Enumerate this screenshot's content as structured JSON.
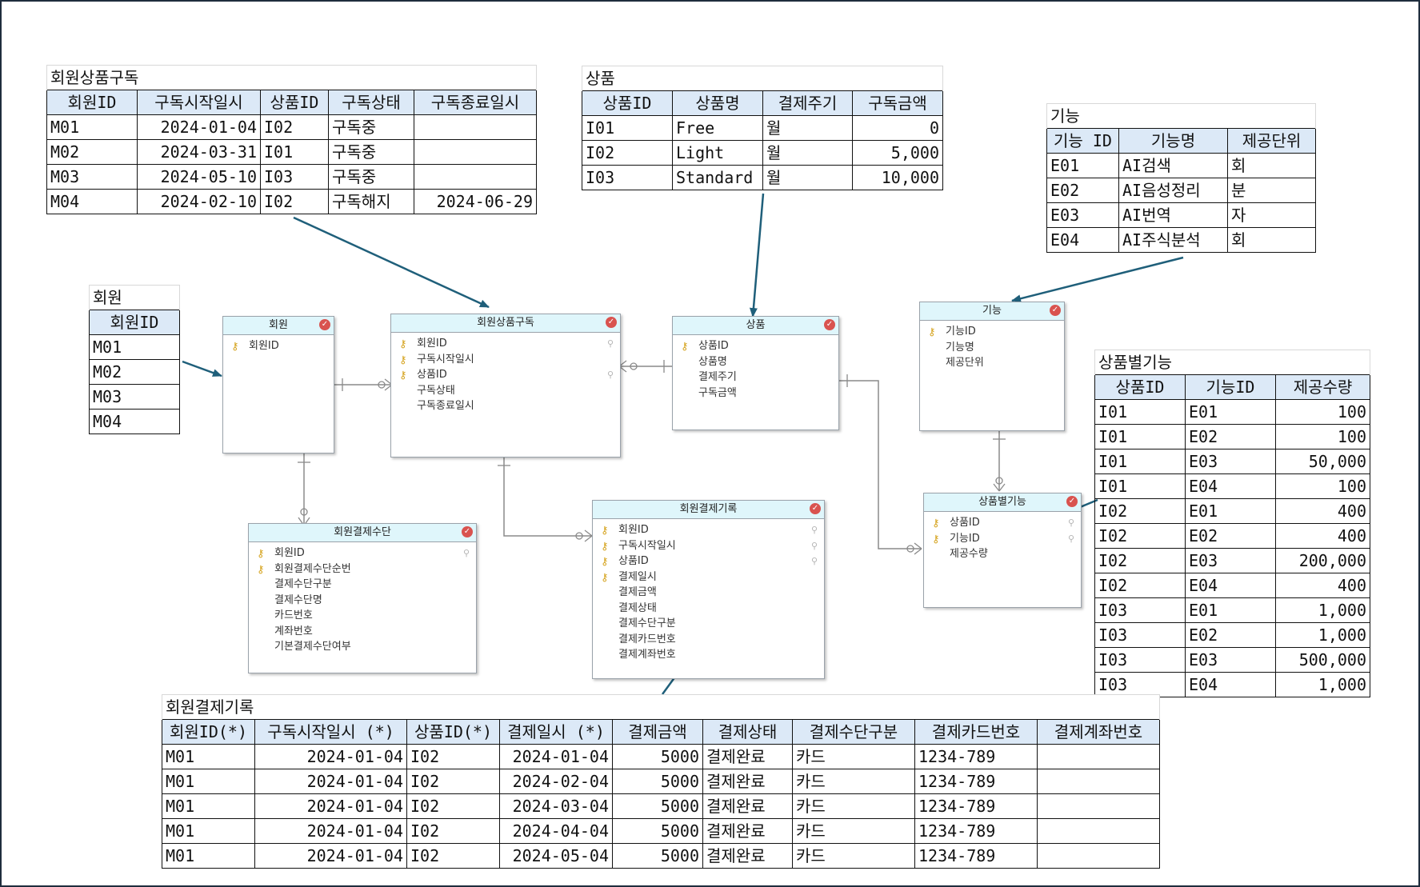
{
  "sample_tables": {
    "subscription": {
      "caption": "회원상품구독",
      "headers": [
        "회원ID",
        "구독시작일시",
        "상품ID",
        "구독상태",
        "구독종료일시"
      ],
      "rows": [
        [
          "M01",
          "2024-01-04",
          "I02",
          "구독중",
          ""
        ],
        [
          "M02",
          "2024-03-31",
          "I01",
          "구독중",
          ""
        ],
        [
          "M03",
          "2024-05-10",
          "I03",
          "구독중",
          ""
        ],
        [
          "M04",
          "2024-02-10",
          "I02",
          "구독해지",
          "2024-06-29"
        ]
      ]
    },
    "product": {
      "caption": "상품",
      "headers": [
        "상품ID",
        "상품명",
        "결제주기",
        "구독금액"
      ],
      "rows": [
        [
          "I01",
          "Free",
          "월",
          "0"
        ],
        [
          "I02",
          "Light",
          "월",
          "5,000"
        ],
        [
          "I03",
          "Standard",
          "월",
          "10,000"
        ]
      ]
    },
    "feature": {
      "caption": "기능",
      "headers": [
        "기능 ID",
        "기능명",
        "제공단위"
      ],
      "rows": [
        [
          "E01",
          "AI검색",
          "회"
        ],
        [
          "E02",
          "AI음성정리",
          "분"
        ],
        [
          "E03",
          "AI번역",
          "자"
        ],
        [
          "E04",
          "AI주식분석",
          "회"
        ]
      ]
    },
    "member": {
      "caption": "회원",
      "headers": [
        "회원ID"
      ],
      "rows": [
        [
          "M01"
        ],
        [
          "M02"
        ],
        [
          "M03"
        ],
        [
          "M04"
        ]
      ]
    },
    "product_feature": {
      "caption": "상품별기능",
      "headers": [
        "상품ID",
        "기능ID",
        "제공수량"
      ],
      "rows": [
        [
          "I01",
          "E01",
          "100"
        ],
        [
          "I01",
          "E02",
          "100"
        ],
        [
          "I01",
          "E03",
          "50,000"
        ],
        [
          "I01",
          "E04",
          "100"
        ],
        [
          "I02",
          "E01",
          "400"
        ],
        [
          "I02",
          "E02",
          "400"
        ],
        [
          "I02",
          "E03",
          "200,000"
        ],
        [
          "I02",
          "E04",
          "400"
        ],
        [
          "I03",
          "E01",
          "1,000"
        ],
        [
          "I03",
          "E02",
          "1,000"
        ],
        [
          "I03",
          "E03",
          "500,000"
        ],
        [
          "I03",
          "E04",
          "1,000"
        ]
      ]
    },
    "payment_record": {
      "caption": "회원결제기록",
      "headers": [
        "회원ID(*)",
        "구독시작일시 (*)",
        "상품ID(*)",
        "결제일시 (*)",
        "결제금액",
        "결제상태",
        "결제수단구분",
        "결제카드번호",
        "결제계좌번호"
      ],
      "rows": [
        [
          "M01",
          "2024-01-04",
          "I02",
          "2024-01-04",
          "5000",
          "결제완료",
          "카드",
          "1234-789",
          ""
        ],
        [
          "M01",
          "2024-01-04",
          "I02",
          "2024-02-04",
          "5000",
          "결제완료",
          "카드",
          "1234-789",
          ""
        ],
        [
          "M01",
          "2024-01-04",
          "I02",
          "2024-03-04",
          "5000",
          "결제완료",
          "카드",
          "1234-789",
          ""
        ],
        [
          "M01",
          "2024-01-04",
          "I02",
          "2024-04-04",
          "5000",
          "결제완료",
          "카드",
          "1234-789",
          ""
        ],
        [
          "M01",
          "2024-01-04",
          "I02",
          "2024-05-04",
          "5000",
          "결제완료",
          "카드",
          "1234-789",
          ""
        ]
      ]
    }
  },
  "entities": {
    "member": {
      "title": "회원",
      "attrs": [
        {
          "name": "회원ID",
          "pk": true,
          "fk": false
        }
      ]
    },
    "subscription": {
      "title": "회원상품구독",
      "attrs": [
        {
          "name": "회원ID",
          "pk": true,
          "fk": true
        },
        {
          "name": "구독시작일시",
          "pk": true,
          "fk": false
        },
        {
          "name": "상품ID",
          "pk": true,
          "fk": true
        },
        {
          "name": "구독상태",
          "pk": false,
          "fk": false
        },
        {
          "name": "구독종료일시",
          "pk": false,
          "fk": false
        }
      ]
    },
    "product": {
      "title": "상품",
      "attrs": [
        {
          "name": "상품ID",
          "pk": true,
          "fk": false
        },
        {
          "name": "상품명",
          "pk": false,
          "fk": false
        },
        {
          "name": "결제주기",
          "pk": false,
          "fk": false
        },
        {
          "name": "구독금액",
          "pk": false,
          "fk": false
        }
      ]
    },
    "feature": {
      "title": "기능",
      "attrs": [
        {
          "name": "기능ID",
          "pk": true,
          "fk": false
        },
        {
          "name": "기능명",
          "pk": false,
          "fk": false
        },
        {
          "name": "제공단위",
          "pk": false,
          "fk": false
        }
      ]
    },
    "product_feature": {
      "title": "상품별기능",
      "attrs": [
        {
          "name": "상품ID",
          "pk": true,
          "fk": true
        },
        {
          "name": "기능ID",
          "pk": true,
          "fk": true
        },
        {
          "name": "제공수량",
          "pk": false,
          "fk": false
        }
      ]
    },
    "payment_method": {
      "title": "회원결제수단",
      "attrs": [
        {
          "name": "회원ID",
          "pk": true,
          "fk": true
        },
        {
          "name": "회원결제수단순번",
          "pk": true,
          "fk": false
        },
        {
          "name": "결제수단구분",
          "pk": false,
          "fk": false
        },
        {
          "name": "결제수단명",
          "pk": false,
          "fk": false
        },
        {
          "name": "카드번호",
          "pk": false,
          "fk": false
        },
        {
          "name": "계좌번호",
          "pk": false,
          "fk": false
        },
        {
          "name": "기본결제수단여부",
          "pk": false,
          "fk": false
        }
      ]
    },
    "payment_record": {
      "title": "회원결제기록",
      "attrs": [
        {
          "name": "회원ID",
          "pk": true,
          "fk": true
        },
        {
          "name": "구독시작일시",
          "pk": true,
          "fk": true
        },
        {
          "name": "상품ID",
          "pk": true,
          "fk": true
        },
        {
          "name": "결제일시",
          "pk": true,
          "fk": false
        },
        {
          "name": "결제금액",
          "pk": false,
          "fk": false
        },
        {
          "name": "결제상태",
          "pk": false,
          "fk": false
        },
        {
          "name": "결제수단구분",
          "pk": false,
          "fk": false
        },
        {
          "name": "결제카드번호",
          "pk": false,
          "fk": false
        },
        {
          "name": "결제계좌번호",
          "pk": false,
          "fk": false
        }
      ]
    }
  },
  "colors": {
    "arrow": "#1f5f7a",
    "relation_line": "#8a8a8a",
    "header_fill": "#dce9f7",
    "entity_header_fill": "#dff6fb"
  },
  "icons": {
    "primary_key": "key-icon",
    "foreign_key": "link-icon",
    "entity_status": "check-icon"
  }
}
